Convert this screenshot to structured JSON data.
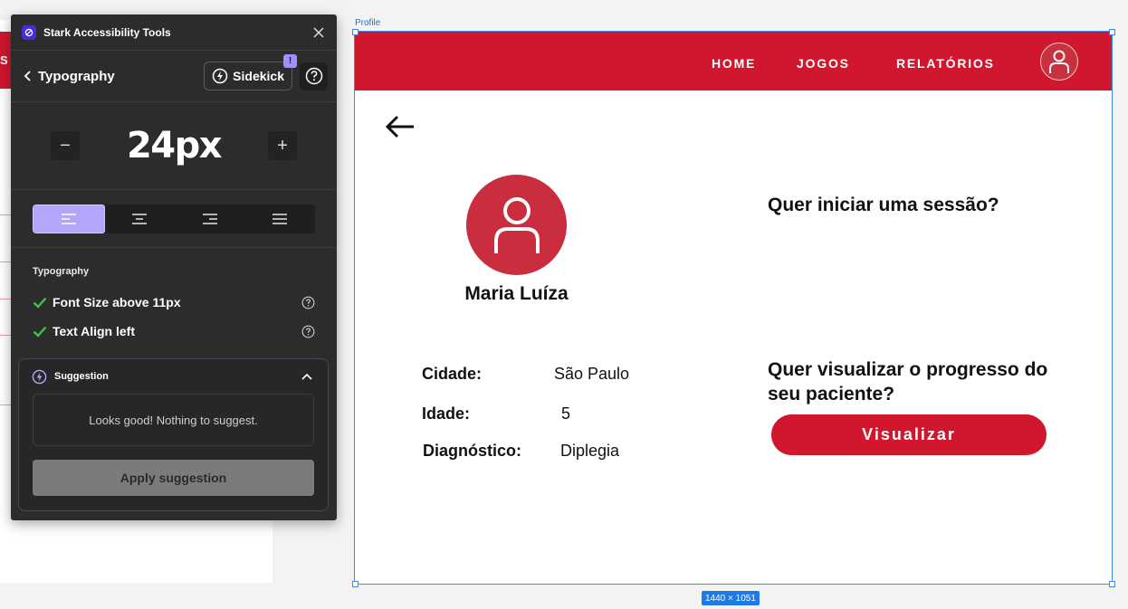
{
  "background": {
    "partial_text": "S"
  },
  "plugin": {
    "title": "Stark Accessibility Tools",
    "section_title": "Typography",
    "sidekick_label": "Sidekick",
    "sidekick_badge": "!",
    "font_size": "24px",
    "decrement": "−",
    "increment": "+",
    "align_options": [
      "left",
      "center",
      "right",
      "justify"
    ],
    "align_selected": "left",
    "checks_label": "Typography",
    "checks": [
      {
        "label": "Font Size above 11px",
        "status": "pass"
      },
      {
        "label": "Text Align left",
        "status": "pass"
      }
    ],
    "suggestion": {
      "title": "Suggestion",
      "message": "Looks good! Nothing to suggest.",
      "apply_label": "Apply suggestion"
    },
    "colors": {
      "accent": "#b4a5fb",
      "check": "#3fbf54",
      "panel": "#2c2c2c"
    }
  },
  "canvas": {
    "frame_name": "Profile",
    "frame_dimensions": "1440 × 1051",
    "nav": {
      "links": [
        "HOME",
        "JOGOS",
        "RELATÓRIOS"
      ]
    },
    "profile": {
      "name": "Maria Luíza",
      "fields": [
        {
          "label": "Cidade:",
          "value": "São Paulo"
        },
        {
          "label": "Idade:",
          "value": "5"
        },
        {
          "label": "Diagnóstico:",
          "value": "Diplegia"
        }
      ]
    },
    "question_session": "Quer iniciar uma sessão?",
    "question_progress": "Quer visualizar o progresso do seu paciente?",
    "view_button": "Visualizar",
    "colors": {
      "brand_red": "#d0172e",
      "avatar_red": "#c92d3e"
    }
  }
}
